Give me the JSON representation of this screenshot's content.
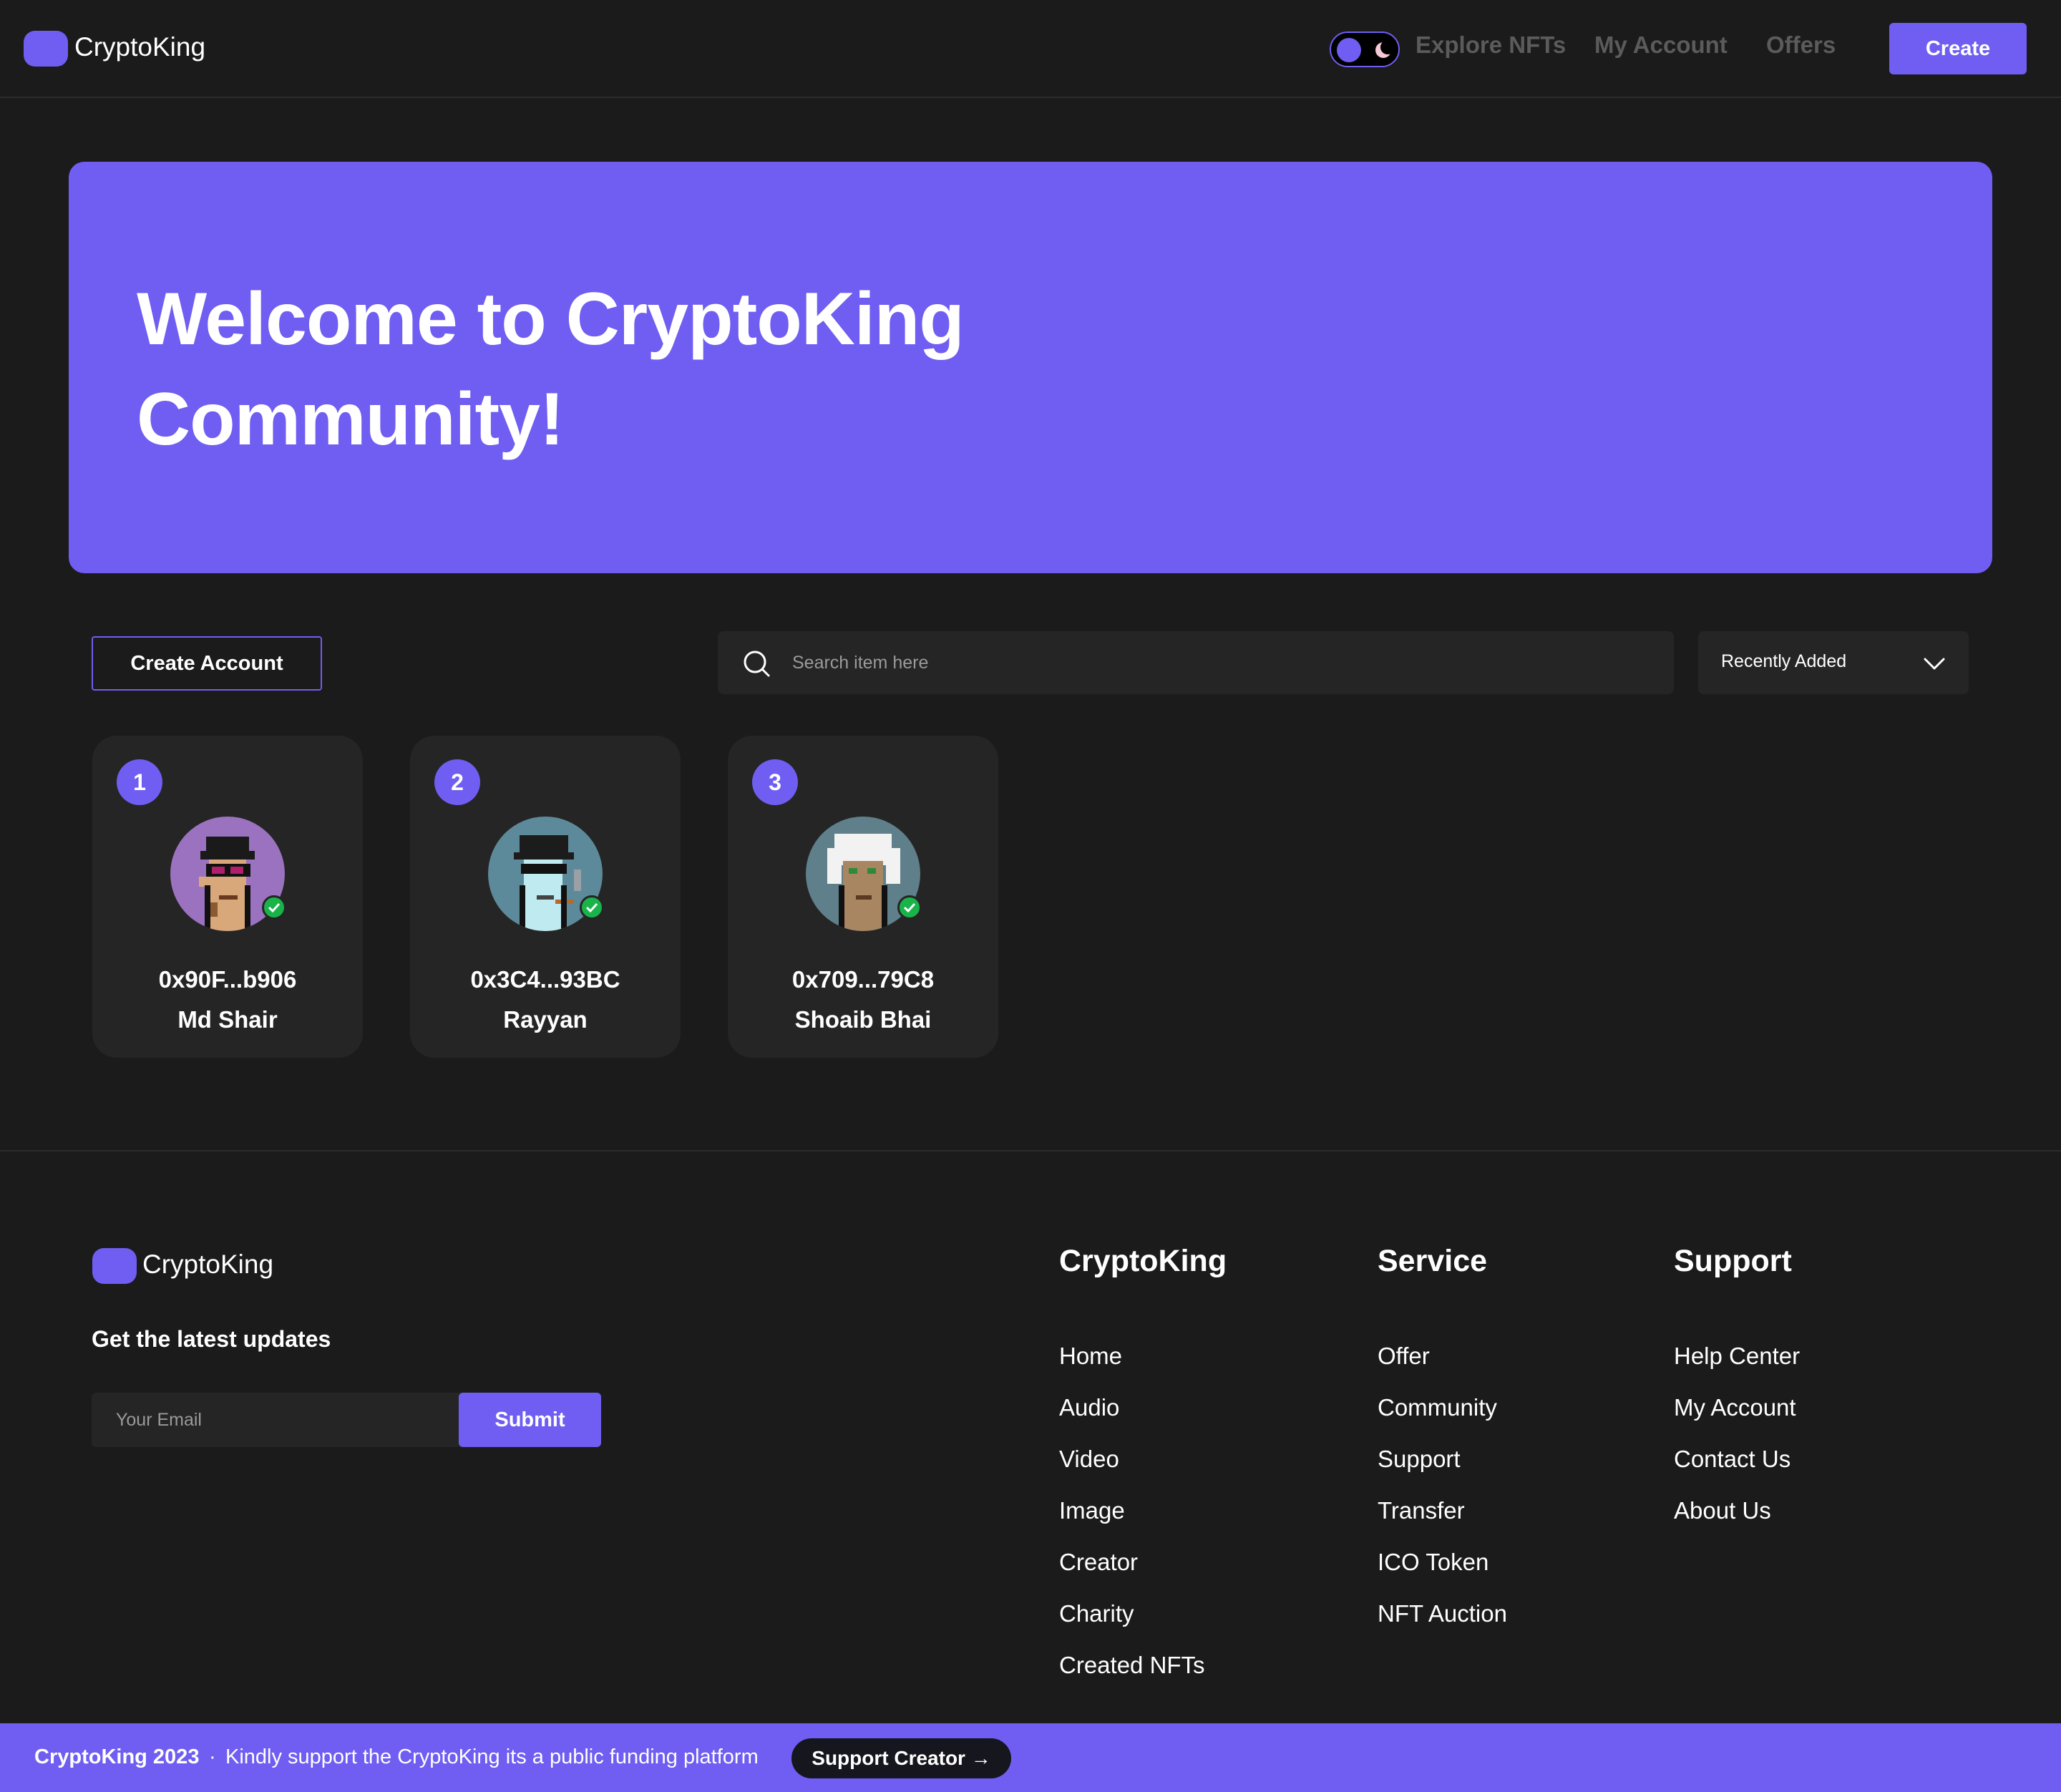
{
  "brand": {
    "name": "CryptoKing",
    "accent": "#6f5ef1"
  },
  "nav": {
    "links": [
      "Explore NFTs",
      "My Account",
      "Offers"
    ],
    "create_label": "Create"
  },
  "hero": {
    "title": "Welcome to CryptoKing Community!"
  },
  "controls": {
    "create_account_label": "Create Account",
    "search_placeholder": "Search item here",
    "sort_selected": "Recently Added"
  },
  "creators": [
    {
      "rank": "1",
      "address": "0x90F...b906",
      "name": "Md Shair"
    },
    {
      "rank": "2",
      "address": "0x3C4...93BC",
      "name": "Rayyan"
    },
    {
      "rank": "3",
      "address": "0x709...79C8",
      "name": "Shoaib Bhai"
    }
  ],
  "footer": {
    "brand": "CryptoKing",
    "updates_label": "Get the latest updates",
    "email_placeholder": "Your Email",
    "submit_label": "Submit",
    "columns": [
      {
        "title": "CryptoKing",
        "links": [
          "Home",
          "Audio",
          "Video",
          "Image",
          "Creator",
          "Charity",
          "Created NFTs"
        ]
      },
      {
        "title": "Service",
        "links": [
          "Offer",
          "Community",
          "Support",
          "Transfer",
          "ICO Token",
          "NFT Auction"
        ]
      },
      {
        "title": "Support",
        "links": [
          "Help Center",
          "My Account",
          "Contact Us",
          "About Us"
        ]
      }
    ]
  },
  "bottom_bar": {
    "copyright": "CryptoKing 2023",
    "separator": "·",
    "tagline": "Kindly support the CryptoKing its a public funding platform",
    "support_label": "Support Creator →"
  }
}
